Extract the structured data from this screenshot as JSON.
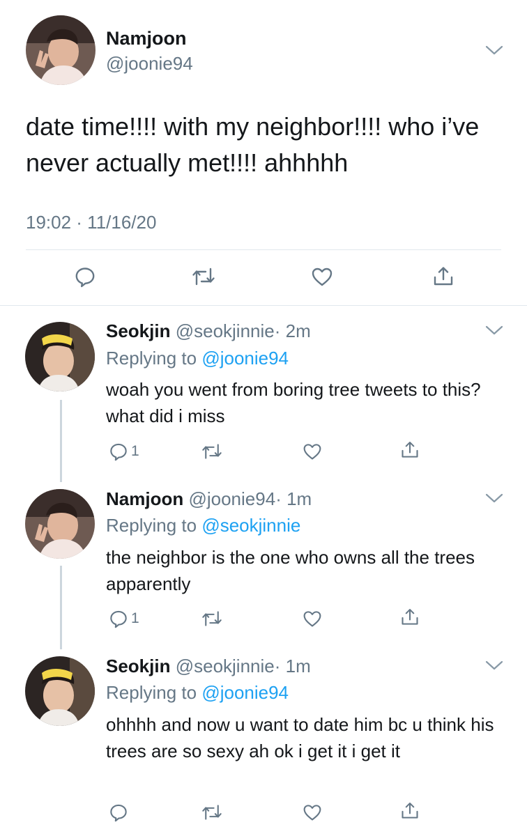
{
  "main_tweet": {
    "name": "Namjoon",
    "handle": "@joonie94",
    "text": "date time!!!! with my neighbor!!!! who i’ve never actually met!!!! ahhhhh",
    "timestamp": "19:02 · 11/16/20"
  },
  "replies": [
    {
      "name": "Seokjin",
      "handle": "@seokjinnie",
      "time": "· 2m",
      "replying_prefix": "Replying to ",
      "replying_to": "@joonie94",
      "text": "woah you went from boring tree tweets to this? what did i miss",
      "reply_count": "1"
    },
    {
      "name": "Namjoon",
      "handle": "@joonie94",
      "time": "· 1m",
      "replying_prefix": "Replying to ",
      "replying_to": "@seokjinnie",
      "text": "the neighbor is the one who owns all the trees apparently",
      "reply_count": "1"
    },
    {
      "name": "Seokjin",
      "handle": "@seokjinnie",
      "time": "· 1m",
      "replying_prefix": "Replying to ",
      "replying_to": "@joonie94",
      "text": "ohhhh and now u want to date him bc u think his trees are so sexy ah ok i get it i get it",
      "reply_count": ""
    }
  ],
  "colors": {
    "text": "#14171a",
    "secondary": "#657786",
    "accent": "#1da1f2",
    "divider": "#e1e8ed"
  },
  "icons": [
    "chevron-down-icon",
    "reply-icon",
    "retweet-icon",
    "like-icon",
    "share-icon"
  ]
}
